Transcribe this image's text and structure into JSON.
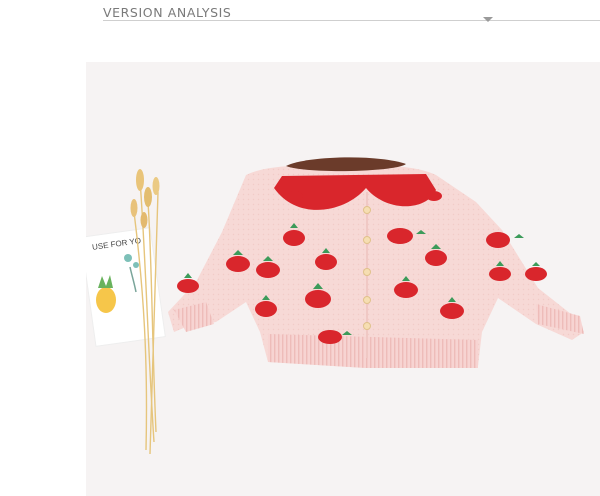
{
  "header": {
    "title": "VERSION ANALYSIS"
  },
  "photo": {
    "card_text": "USE FOR YO",
    "colors": {
      "background": "#f6f3f3",
      "sweater": "#f7d9d6",
      "strawberry": "#d9262c",
      "leaf": "#3c9b5a",
      "wheat": "#e3c27a"
    }
  }
}
